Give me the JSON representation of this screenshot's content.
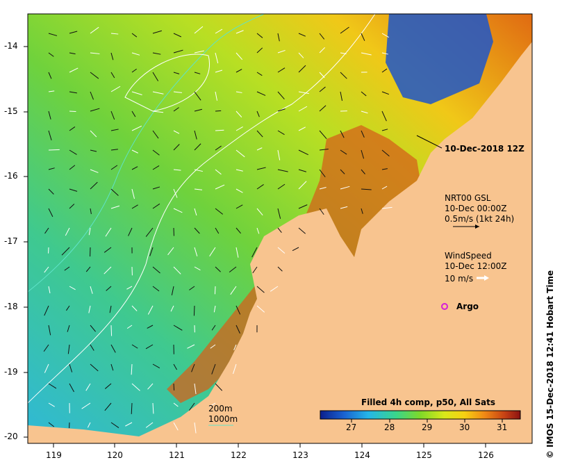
{
  "annotation_time": "10-Dec-2018 12Z",
  "currents": {
    "title": "NRT00 GSL",
    "time": "10-Dec 00:00Z",
    "scale": "0.5m/s (1kt 24h)"
  },
  "wind": {
    "title": "WindSpeed",
    "time": "10-Dec 12:00Z",
    "scale": "10 m/s"
  },
  "argo_label": "Argo",
  "isobaths": [
    "200m",
    "1000m"
  ],
  "colorbar": {
    "title": "Filled 4h comp, p50, All Sats",
    "ticks": [
      "27",
      "28",
      "29",
      "30",
      "31"
    ]
  },
  "credit": "© IMOS 15-Dec-2018 12:41 Hobart Time",
  "axes": {
    "x_ticks": [
      "119",
      "120",
      "121",
      "122",
      "123",
      "124",
      "125",
      "126"
    ],
    "y_ticks": [
      "-14",
      "-15",
      "-16",
      "-17",
      "-18",
      "-19",
      "-20"
    ]
  },
  "colors": {
    "land": "#f8c48f",
    "isobath_200": "#5fe3c8",
    "isobath_1000": "#ffffff",
    "colorbar_stops": [
      "#0c1f8c",
      "#1a63d1",
      "#25b6e8",
      "#3ad68a",
      "#7fd829",
      "#d9e81a",
      "#f6d112",
      "#f08a15",
      "#c74214",
      "#8b1212"
    ]
  }
}
